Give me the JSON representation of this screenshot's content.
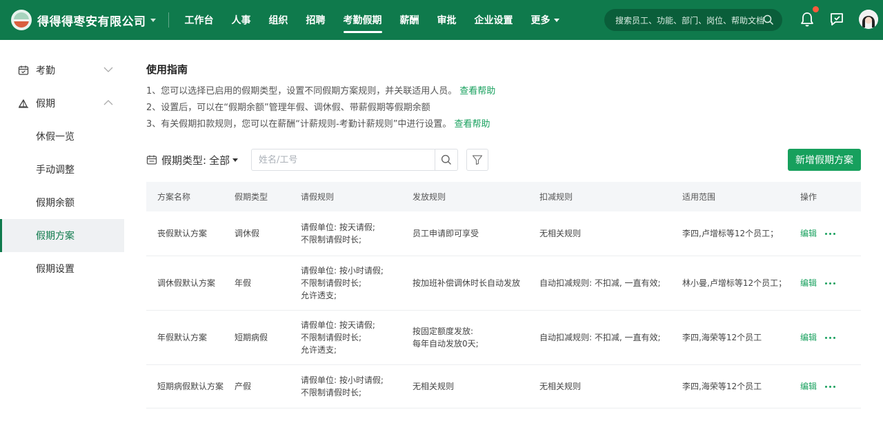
{
  "topbar": {
    "company": "得得得枣安有限公司",
    "nav": [
      "工作台",
      "人事",
      "组织",
      "招聘",
      "考勤假期",
      "薪酬",
      "审批",
      "企业设置",
      "更多"
    ],
    "active_nav": "考勤假期",
    "search_placeholder": "搜索员工、功能、部门、岗位、帮助文档",
    "brand_color": "#0f7a4c",
    "notification_dot_color": "#ff5a3c"
  },
  "sidebar": {
    "groups": [
      {
        "label": "考勤",
        "icon": "calendar-icon",
        "expanded": false
      },
      {
        "label": "假期",
        "icon": "umbrella-icon",
        "expanded": true
      }
    ],
    "items": [
      "休假一览",
      "手动调整",
      "假期余额",
      "假期方案",
      "假期设置"
    ],
    "active_item": "假期方案"
  },
  "guide": {
    "title": "使用指南",
    "line1": "1、您可以选择已启用的假期类型，设置不同假期方案规则，并关联适用人员。",
    "line2": "2、设置后，可以在“假期余额”管理年假、调休假、带薪假期等假期余额",
    "line3": "3、有关假期扣款规则，您可以在薪酬“计薪规则-考勤计薪规则”中进行设置。",
    "help_link": "查看帮助"
  },
  "filter": {
    "label": "假期类型:",
    "value": "全部",
    "name_placeholder": "姓名/工号"
  },
  "add_button": "新增假期方案",
  "table": {
    "headers": [
      "方案名称",
      "假期类型",
      "请假规则",
      "发放规则",
      "扣减规则",
      "适用范围",
      "操作"
    ],
    "rows": [
      {
        "name": "丧假默认方案",
        "type": "调休假",
        "leave_rule": [
          "请假单位: 按天请假;",
          "不限制请假时长;"
        ],
        "grant_rule": [
          "员工申请即可享受"
        ],
        "deduct_rule": "无相关规则",
        "scope": "李四,卢增标等12个员工；",
        "action": "编辑"
      },
      {
        "name": "调休假默认方案",
        "type": "年假",
        "leave_rule": [
          "请假单位: 按小时请假;",
          "不限制请假时长;",
          "允许透支;"
        ],
        "grant_rule": [
          "按加班补偿调休时长自动发放"
        ],
        "deduct_rule": "自动扣减规则: 不扣减, 一直有效;",
        "scope": "林小曼,卢增标等12个员工；",
        "action": "编辑"
      },
      {
        "name": "年假默认方案",
        "type": "短期病假",
        "leave_rule": [
          "请假单位: 按天请假;",
          "不限制请假时长;",
          "允许透支;"
        ],
        "grant_rule": [
          "按固定额度发放:",
          "每年自动发放0天;"
        ],
        "deduct_rule": "自动扣减规则: 不扣减, 一直有效;",
        "scope": "李四,海荣等12个员工",
        "action": "编辑"
      },
      {
        "name": "短期病假默认方案",
        "type": "产假",
        "leave_rule": [
          "请假单位: 按小时请假;",
          "不限制请假时长;"
        ],
        "grant_rule": [
          "无相关规则"
        ],
        "deduct_rule": "无相关规则",
        "scope": "李四,海荣等12个员工",
        "action": "编辑"
      }
    ]
  }
}
